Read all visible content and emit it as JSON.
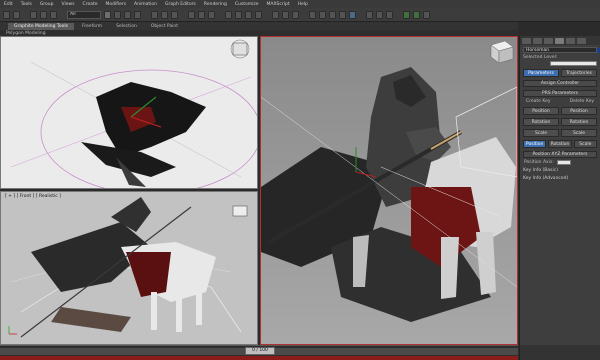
{
  "menubar": [
    "Edit",
    "Tools",
    "Group",
    "Views",
    "Create",
    "Modifiers",
    "Animation",
    "Graph Editors",
    "Rendering",
    "Customize",
    "MAXScript",
    "Help"
  ],
  "toolbar": {
    "selection_filter": "All"
  },
  "ribbon": {
    "tabs": [
      "Graphite Modeling Tools",
      "Freeform",
      "Selection",
      "Object Paint"
    ],
    "active_tab": "Graphite Modeling Tools",
    "panel_label": "Polygon Modeling"
  },
  "viewports": {
    "top_label": "",
    "front_label": "[ + ] [ Front ] [ Realistic ]",
    "persp_label": ""
  },
  "command_panel": {
    "object_name": "Horseman",
    "selected_level_label": "Selected Level:",
    "tabs": [
      "Parameters",
      "Trajectories"
    ],
    "active_tab": "Parameters",
    "assign_controller": "Assign Controller",
    "pry_parameters": "PRS Parameters",
    "create_key": "Create Key",
    "delete_key": "Delete Key",
    "key_buttons": [
      "Position",
      "Position",
      "Rotation",
      "Rotation",
      "Scale",
      "Scale"
    ],
    "prs_buttons": [
      "Position",
      "Rotation",
      "Scale"
    ],
    "active_prs": "Position",
    "xyz_parameters": "Position XYZ Parameters",
    "position_axis_label": "Position Axis:",
    "key_info_basic": "Key Info (Basic)",
    "key_info_advanced": "Key Info (Advanced)"
  },
  "timeline": {
    "frame_label": "0 / 100"
  },
  "colors": {
    "ui_dark": "#2b2b2b",
    "active_blue": "#3d6fb0",
    "persp_border": "#b03030",
    "timeline_red": "#8a1c1c"
  }
}
